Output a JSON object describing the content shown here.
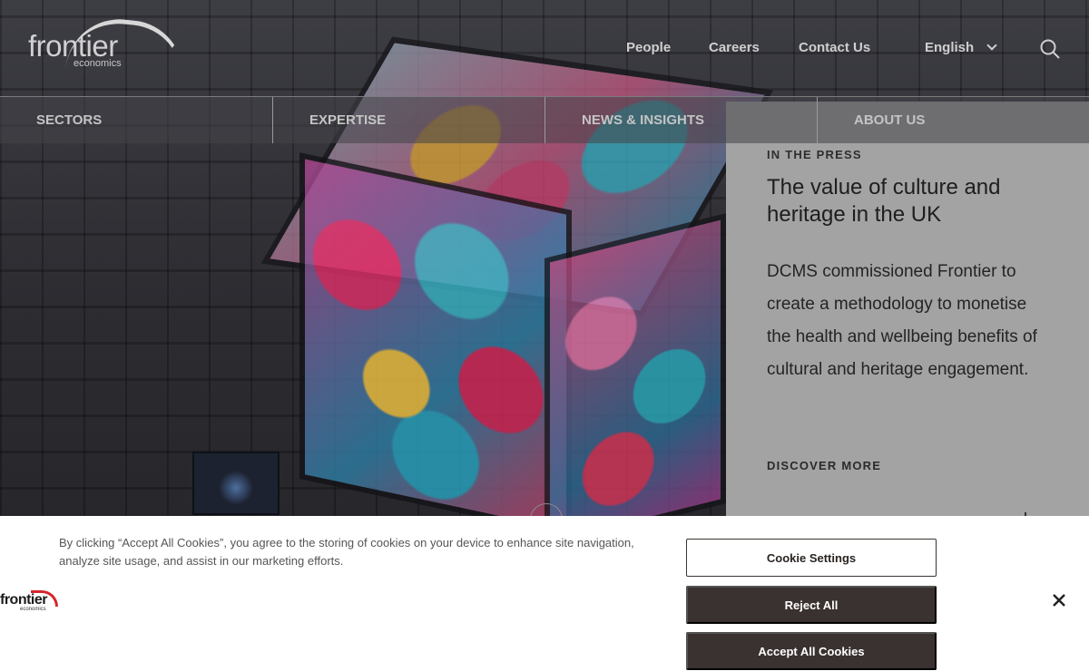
{
  "header": {
    "logo_word": "frontier",
    "logo_sub": "economics",
    "top_nav": [
      "People",
      "Careers",
      "Contact Us"
    ],
    "language": "English"
  },
  "main_nav": [
    "SECTORS",
    "EXPERTISE",
    "NEWS & INSIGHTS",
    "ABOUT US"
  ],
  "feature": {
    "eyebrow": "IN THE PRESS",
    "title": "The value of culture and heritage in the UK",
    "body": "DCMS commissioned Frontier to create a methodology to monetise the health and wellbeing benefits of cultural and heritage engagement.",
    "cta": "DISCOVER MORE"
  },
  "cookie_banner": {
    "text": "By clicking “Accept All Cookies”, you agree to the storing of cookies on your device to enhance site navigation, analyze site usage, and assist in our marketing efforts.",
    "logo_word": "frontier",
    "logo_sub": "economics",
    "settings_label": "Cookie Settings",
    "reject_label": "Reject All",
    "accept_label": "Accept All Cookies",
    "close_icon": "close-icon"
  },
  "colors": {
    "panel": "#a3a3a3",
    "button_dark": "#3a3230",
    "logo_accent": "#d6262e"
  }
}
